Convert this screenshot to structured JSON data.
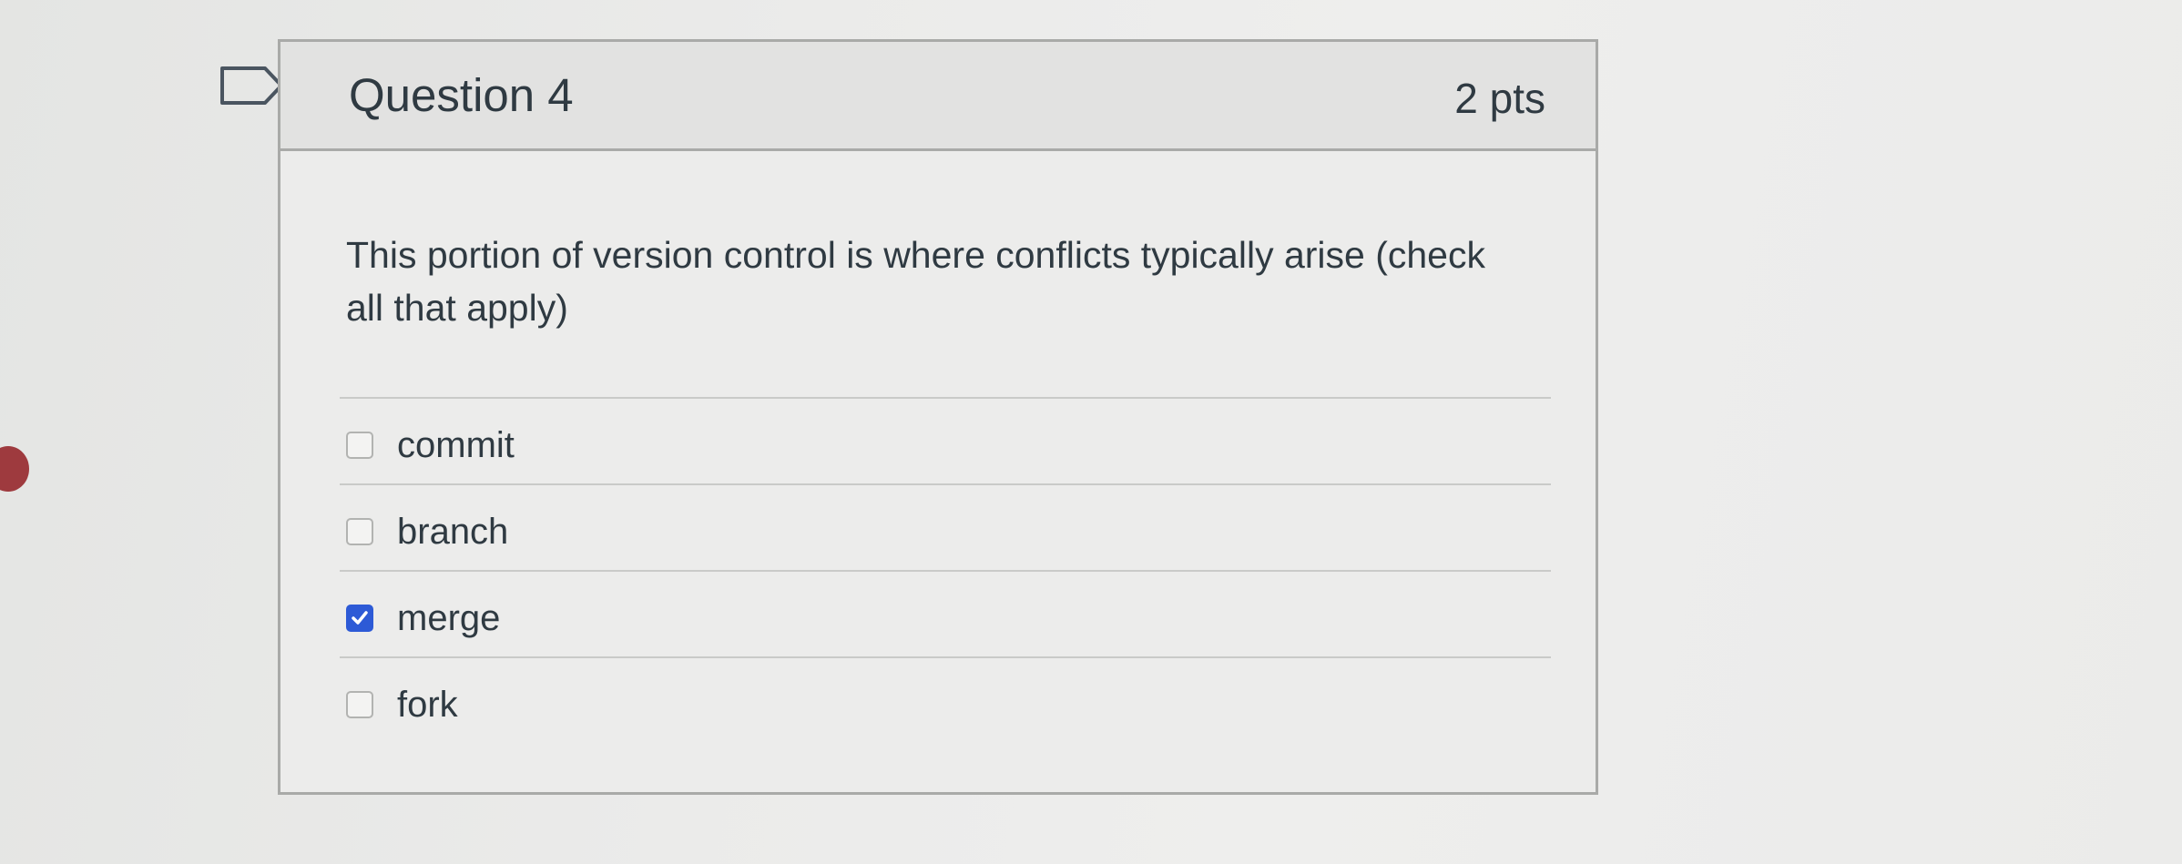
{
  "question": {
    "title": "Question 4",
    "points": "2 pts",
    "text_line1": "This portion of version control is where conflicts typically arise (check",
    "text_line2": "all that apply)"
  },
  "answers": [
    {
      "label": "commit",
      "checked": false
    },
    {
      "label": "branch",
      "checked": false
    },
    {
      "label": "merge",
      "checked": true
    },
    {
      "label": "fork",
      "checked": false
    }
  ],
  "icons": {
    "bookmark": "bookmark-flag-icon",
    "checkmark": "checkmark-icon"
  },
  "colors": {
    "checked_accent": "#2d5ad6",
    "side_dot": "#9e3a3e"
  }
}
